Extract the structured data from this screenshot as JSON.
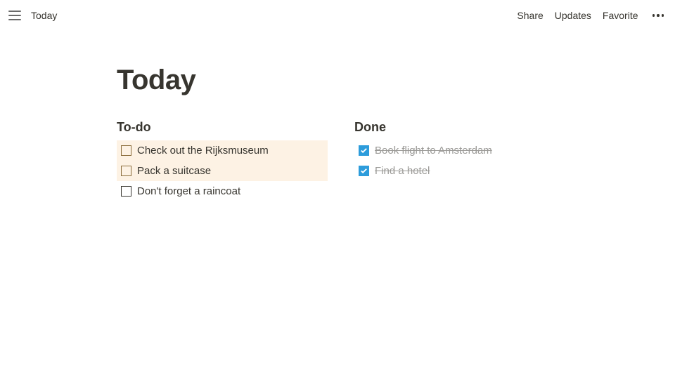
{
  "topbar": {
    "breadcrumb": "Today",
    "share": "Share",
    "updates": "Updates",
    "favorite": "Favorite"
  },
  "page": {
    "title": "Today"
  },
  "columns": {
    "todo": {
      "heading": "To-do",
      "items": [
        {
          "label": "Check out the Rijksmuseum",
          "highlight": true
        },
        {
          "label": "Pack a suitcase",
          "highlight": true
        },
        {
          "label": "Don't forget a raincoat",
          "highlight": false
        }
      ]
    },
    "done": {
      "heading": "Done",
      "items": [
        {
          "label": "Book flight to Amsterdam"
        },
        {
          "label": "Find a hotel"
        }
      ]
    }
  },
  "colors": {
    "accent_checked": "#2d9cdb",
    "highlight_bg": "#fdf2e4"
  }
}
